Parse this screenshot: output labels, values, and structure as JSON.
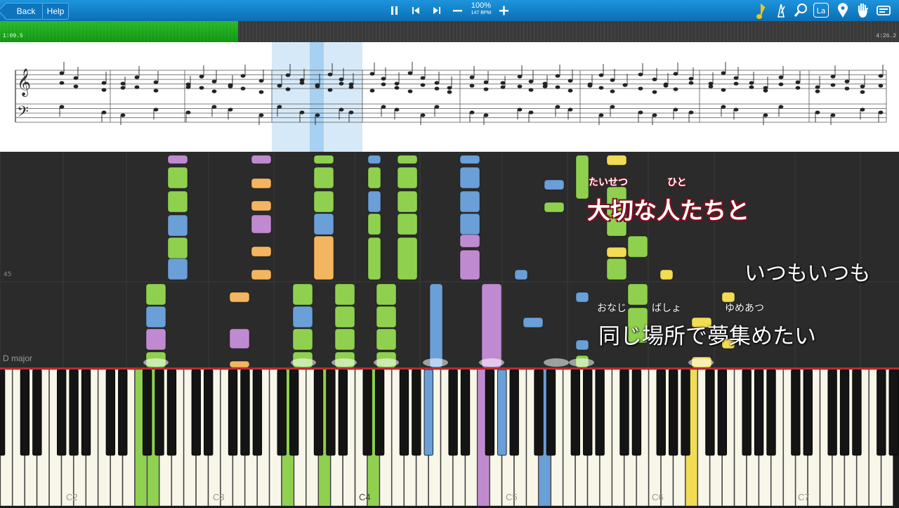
{
  "toolbar": {
    "back_label": "Back",
    "help_label": "Help",
    "tempo_percent": "100%",
    "tempo_bpm": "147 BPM",
    "icons": [
      "pause-icon",
      "rewind-icon",
      "forward-icon",
      "minus-icon",
      "plus-icon",
      "note-icon",
      "metronome-icon",
      "magnifier-icon",
      "solfege-icon",
      "location-pin-icon",
      "hand-icon",
      "settings-icon"
    ],
    "solfege_label": "La"
  },
  "progress": {
    "elapsed": "1:09.5",
    "total": "4:26.2",
    "fraction": 0.265
  },
  "falling": {
    "measure_number": "45",
    "key_signature": "D major"
  },
  "lyrics": {
    "line1_ruby_a": "たいせつ",
    "line1_ruby_b": "ひと",
    "line1": "大切な人たちと",
    "line2": "いつもいつも",
    "line3_ruby_a": "おなじ",
    "line3_ruby_b": "ばしょ",
    "line3_ruby_c": "ゆめあつ",
    "line3": "同じ場所で夢集めたい"
  },
  "keyboard": {
    "octave_labels": [
      "C2",
      "C3",
      "C4",
      "C5",
      "C6",
      "C7"
    ],
    "colors": {
      "green": "#8fd14f",
      "blue": "#6a9fd8",
      "purple": "#c08ad0",
      "yellow": "#f1dc54",
      "orange": "#f4b560"
    }
  }
}
